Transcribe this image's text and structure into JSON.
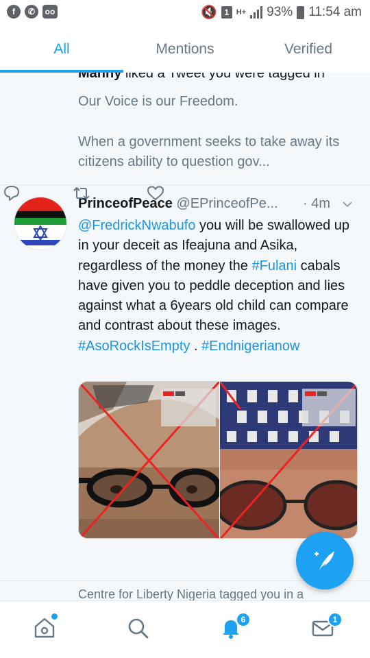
{
  "status_bar": {
    "battery": "93%",
    "time": "11:54 am",
    "sim_slot": "1",
    "network": "H+",
    "icons": [
      "facebook-icon",
      "whatsapp-icon",
      "voicemail-icon",
      "mute-icon",
      "signal-icon"
    ]
  },
  "tabs": [
    {
      "label": "All",
      "active": true
    },
    {
      "label": "Mentions",
      "active": false
    },
    {
      "label": "Verified",
      "active": false
    }
  ],
  "notifications": {
    "liked": {
      "user": "Manny",
      "action": " liked a Tweet you were tagged in",
      "line1": "Our Voice is our Freedom.",
      "line2": "When a government seeks to take away its citizens ability to question gov..."
    },
    "tweet": {
      "name": "PrinceofPeace",
      "handle": "@EPrinceofPe...",
      "time": "· 4m",
      "body": {
        "mention": "@FredrickNwabufo",
        "text1": " you will be swallowed up in your deceit as Ifeajuna and Asika, regardless of the money the ",
        "hashtag1": "#Fulani",
        "text2": " cabals have given you to peddle deception and lies against what a 6years old child can compare and contrast about these images. ",
        "hashtag2": "#AsoRockIsEmpty",
        "text3": " . ",
        "hashtag3": "#Endnigerianow"
      },
      "photo_labels": {
        "live": "LIVE",
        "viewers": "5.4K"
      }
    },
    "next": {
      "text": "Centre for Liberty Nigeria tagged you in a"
    }
  },
  "bottom_nav": {
    "notifications_badge": "6",
    "messages_badge": "1"
  },
  "colors": {
    "accent": "#1da1f2",
    "link": "#1b95e0",
    "muted": "#657786",
    "feed_bg": "#f5f8fa"
  }
}
